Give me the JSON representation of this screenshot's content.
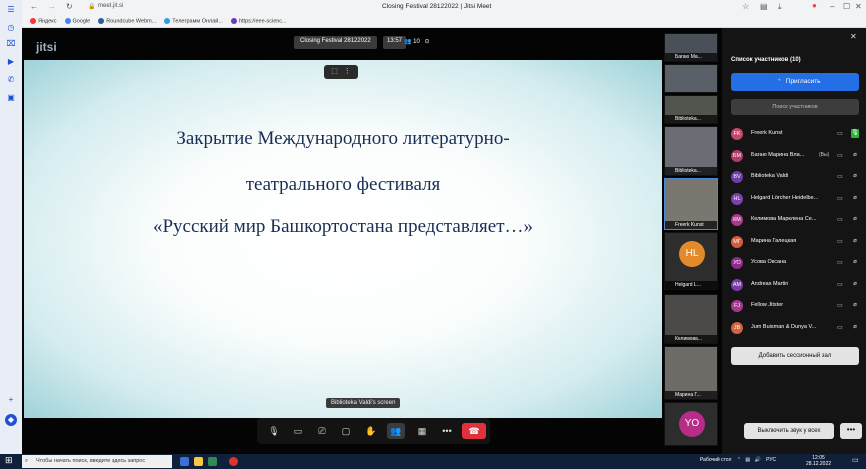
{
  "browser": {
    "tab_title": "Closing Festival 28122022 | Jitsi Meet",
    "url": "meet.jit.si",
    "bookmarks": [
      "Яндекс",
      "Google",
      "Roundcube Webm...",
      "Телеграмм Онлай...",
      "https://eee-scienc..."
    ],
    "bookmark_colors": [
      "#ff3333",
      "#4285f4",
      "#2a5aa0",
      "#2aa0e0",
      "#6a3ab8"
    ]
  },
  "meeting": {
    "logo": "jitsi",
    "title": "Closing Festival 28122022",
    "timer": "13:57",
    "participant_count": "10"
  },
  "slide": {
    "line1": "Закрытие Международного литературно-",
    "line2": "театрального фестиваля",
    "line3": "«Русский мир Башкортостана представляет…»"
  },
  "screen_label": "Biblioteka Valdi's screen",
  "filmstrip": [
    {
      "name": "Багаю Ма...",
      "type": "video"
    },
    {
      "name": "",
      "type": "video"
    },
    {
      "name": "Biblioteka...",
      "type": "video"
    },
    {
      "name": "Biblioteka...",
      "type": "video"
    },
    {
      "name": "Freerk Kunst",
      "type": "video",
      "selected": true
    },
    {
      "name": "Helgard L...",
      "type": "avatar",
      "initials": "HL",
      "color": "#e38a2a"
    },
    {
      "name": "Келимова...",
      "type": "video"
    },
    {
      "name": "Марина Г...",
      "type": "video"
    },
    {
      "name": "",
      "type": "avatar",
      "initials": "YO",
      "color": "#b62c86"
    }
  ],
  "panel": {
    "title": "Список участников (10)",
    "invite": "Пригласить",
    "search_placeholder": "Поиск участников",
    "participants": [
      {
        "initials": "FK",
        "name": "Freerk Kunst",
        "color": "#c2476b",
        "mic_on": true
      },
      {
        "initials": "БМ",
        "name": "Багаю Марина Вла...",
        "you": "(Вы)",
        "color": "#b03c6c"
      },
      {
        "initials": "BV",
        "name": "Biblioteka Valdi",
        "color": "#6b3fa8"
      },
      {
        "initials": "HL",
        "name": "Helgard Lörcher Heidelbe...",
        "color": "#7e3fb0"
      },
      {
        "initials": "КМ",
        "name": "Келимова Марклена Се...",
        "color": "#a8398c"
      },
      {
        "initials": "МГ",
        "name": "Марина Галецкая",
        "color": "#d35d3e"
      },
      {
        "initials": "УО",
        "name": "Усова Оксана",
        "color": "#8f2c8a"
      },
      {
        "initials": "AM",
        "name": "Andreas Martin",
        "color": "#7a3da6"
      },
      {
        "initials": "FJ",
        "name": "Fellow Jitster",
        "color": "#a23b8c"
      },
      {
        "initials": "JB",
        "name": "Jum Buisman & Dunya V...",
        "color": "#d0643f"
      }
    ],
    "breakout": "Добавить сессионный зал",
    "mute_all": "Выключить звук у всех",
    "more": "•••"
  },
  "taskbar": {
    "search_placeholder": "Чтобы начать поиск, введите здесь запрос",
    "desktop_label": "Рабочий стол",
    "lang": "РУС",
    "time": "12:05",
    "date": "28.12.2022"
  }
}
